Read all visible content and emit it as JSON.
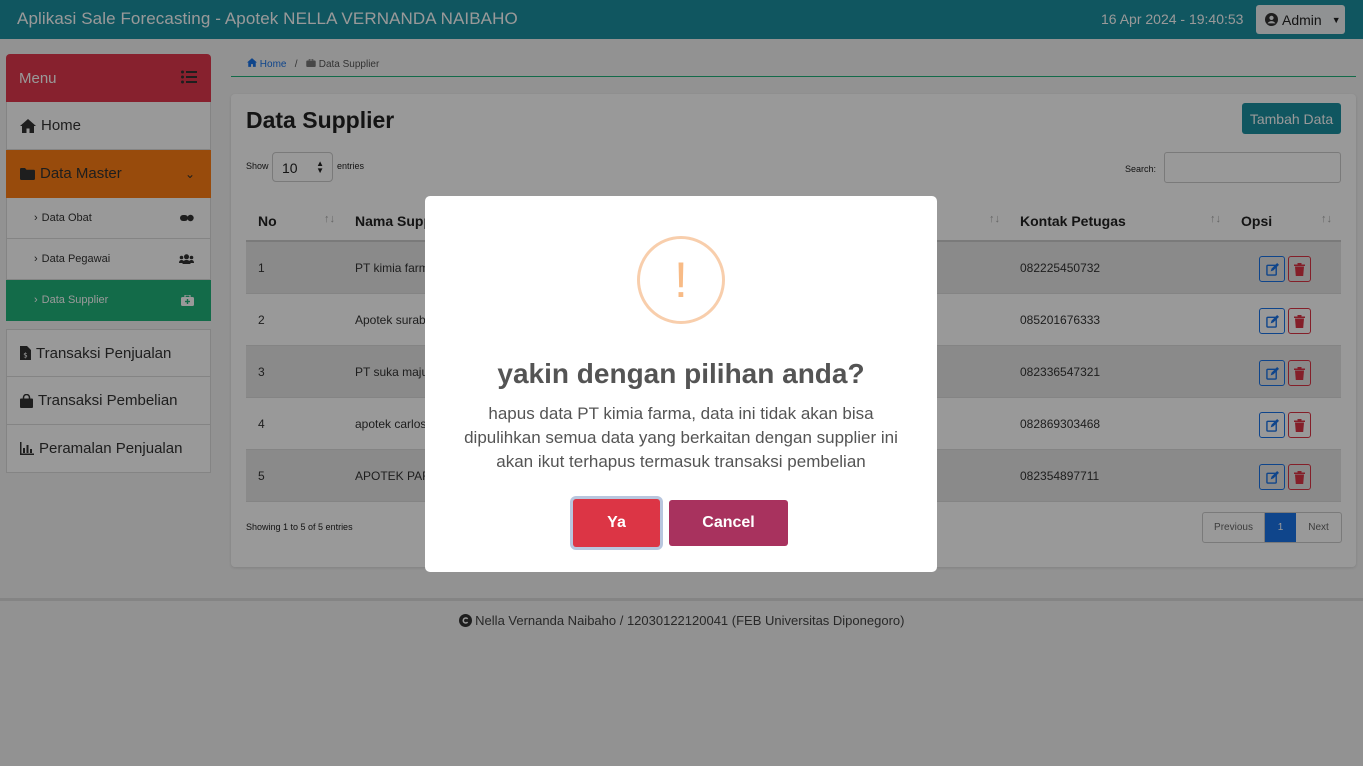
{
  "header": {
    "app_title": "Aplikasi Sale Forecasting - Apotek NELLA VERNANDA NAIBAHO",
    "date": "16 Apr 2024 - ",
    "time": "19:40:53",
    "user": "Admin"
  },
  "sidebar": {
    "menu_label": "Menu",
    "home": "Home",
    "data_master": "Data Master",
    "sub_items": [
      "Data Obat",
      "Data Pegawai",
      "Data Supplier"
    ],
    "items": [
      "Transaksi Penjualan",
      "Transaksi Pembelian",
      "Peramalan Penjualan"
    ]
  },
  "breadcrumb": {
    "home": "Home",
    "current": "Data Supplier"
  },
  "page": {
    "title": "Data Supplier",
    "add_button": "Tambah Data",
    "show_label": "Show",
    "page_length": "10",
    "entries_label": "entries",
    "search_label": "Search:",
    "info": "Showing 1 to 5 of 5 entries",
    "pagination": {
      "prev": "Previous",
      "current": "1",
      "next": "Next"
    }
  },
  "table": {
    "headers": {
      "no": "No",
      "nama": "Nama Supp",
      "kontak": "Kontak Petugas",
      "opsi": "Opsi"
    },
    "rows": [
      {
        "no": "1",
        "nama": "PT kimia farm",
        "kontak": "082225450732"
      },
      {
        "no": "2",
        "nama": "Apotek surab",
        "kontak": "085201676333"
      },
      {
        "no": "3",
        "nama": "PT suka maju",
        "kontak": "082336547321"
      },
      {
        "no": "4",
        "nama": "apotek carlos",
        "kontak": "082869303468"
      },
      {
        "no": "5",
        "nama": "APOTEK PARS",
        "kontak": "082354897711"
      }
    ]
  },
  "footer": {
    "text": "Nella Vernanda Naibaho / 12030122120041 (FEB Universitas Diponegoro)"
  },
  "modal": {
    "icon": "!",
    "title": "yakin dengan pilihan anda?",
    "lines": [
      "hapus data PT kimia farma, data ini tidak akan bisa",
      "dipulihkan semua data yang berkaitan dengan supplier ini",
      "akan ikut terhapus termasuk transaksi pembelian"
    ],
    "confirm": "Ya",
    "cancel": "Cancel"
  },
  "colors": {
    "topbar": "#1c8fa0",
    "menu_header": "#e2384d",
    "data_master": "#fd7e14",
    "active": "#20b27a",
    "confirm": "#dc3545",
    "cancel": "#a8325e",
    "warning_icon": "#f8bb86"
  }
}
